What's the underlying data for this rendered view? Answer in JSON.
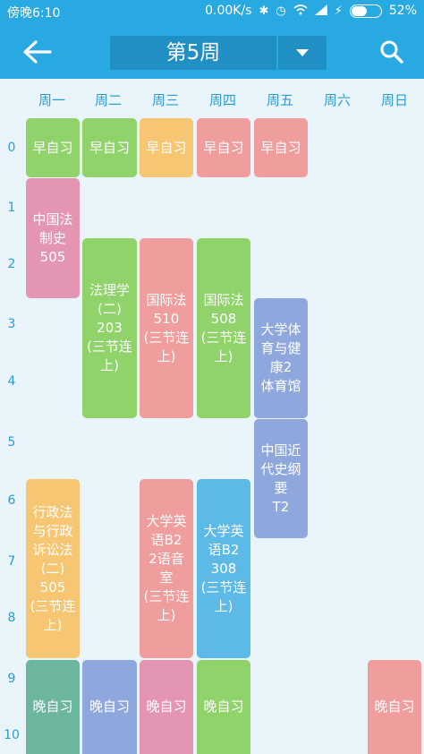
{
  "status_bar": {
    "time": "傍晚6:10",
    "network_speed": "0.00K/s",
    "battery_percent": "52%",
    "battery_level": 0.52
  },
  "header": {
    "week_label": "第5周"
  },
  "days": [
    "周一",
    "周二",
    "周三",
    "周四",
    "周五",
    "周六",
    "周日"
  ],
  "periods": [
    "0",
    "1",
    "2",
    "3",
    "4",
    "5",
    "6",
    "7",
    "8",
    "9",
    "10"
  ],
  "colors": {
    "appbar": "#29a9e1",
    "green": "#8fd36a",
    "yellow": "#f6c672",
    "salmon": "#ef9d9d",
    "pink": "#e595b4",
    "blue_gray": "#8ea8de",
    "sky": "#5db9e6",
    "teal": "#6cb59e"
  },
  "courses": [
    {
      "text": "早自习",
      "color": "#8fd36a"
    },
    {
      "text": "早自习",
      "color": "#8fd36a"
    },
    {
      "text": "早自习",
      "color": "#f6c672"
    },
    {
      "text": "早自习",
      "color": "#ef9d9d"
    },
    {
      "text": "早自习",
      "color": "#ef9d9d"
    },
    {
      "text": "中国法\n制史\n505",
      "color": "#e595b4"
    },
    {
      "text": "法理学\n(二)\n203\n(三节连\n上)",
      "color": "#8fd36a"
    },
    {
      "text": "国际法\n510\n(三节连\n上)",
      "color": "#ef9d9d"
    },
    {
      "text": "国际法\n508\n(三节连\n上)",
      "color": "#8fd36a"
    },
    {
      "text": "大学体\n育与健\n康2\n体育馆",
      "color": "#8ea8de"
    },
    {
      "text": "中国近\n代史纲\n要\nT2",
      "color": "#8ea8de"
    },
    {
      "text": "行政法\n与行政\n诉讼法\n(二)\n505\n(三节连\n上)",
      "color": "#f6c672"
    },
    {
      "text": "大学英\n语B2\n2语音室\n(三节连\n上)",
      "color": "#ef9d9d"
    },
    {
      "text": "大学英\n语B2\n308\n(三节连\n上)",
      "color": "#5db9e6"
    },
    {
      "text": "晚自习",
      "color": "#6cb59e"
    },
    {
      "text": "晚自习",
      "color": "#8ea8de"
    },
    {
      "text": "晚自习",
      "color": "#e595b4"
    },
    {
      "text": "晚自习",
      "color": "#8fd36a"
    },
    {
      "text": "晚自习",
      "color": "#ef9d9d"
    }
  ]
}
